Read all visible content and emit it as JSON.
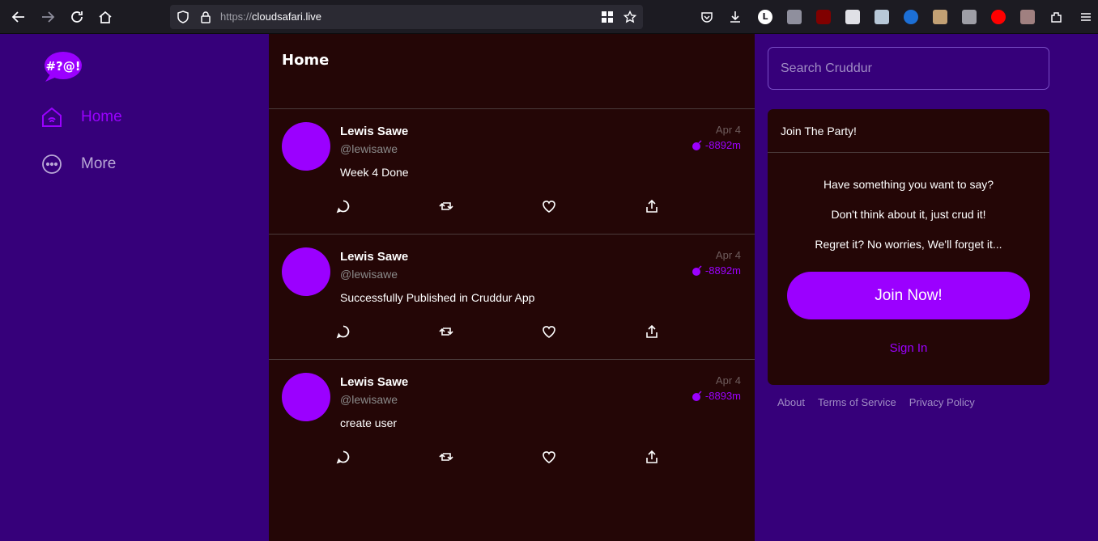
{
  "browser": {
    "url_scheme": "https://",
    "url_host": "cloudsafari.live",
    "icons": [
      "back-icon",
      "forward-icon",
      "reload-icon",
      "home-icon",
      "shield-icon",
      "lock-icon",
      "grid-icon",
      "star-icon",
      "pocket-icon",
      "download-icon",
      "extensions-icon",
      "menu-icon"
    ]
  },
  "app": {
    "logo_text": "#?@!",
    "nav": [
      {
        "label": "Home",
        "icon": "home-icon",
        "active": true
      },
      {
        "label": "More",
        "icon": "more-icon",
        "active": false
      }
    ]
  },
  "feed": {
    "title": "Home",
    "posts": [
      {
        "name": "Lewis Sawe",
        "handle": "@lewisawe",
        "text": "Week 4 Done",
        "date": "Apr 4",
        "expiry": "-8892m"
      },
      {
        "name": "Lewis Sawe",
        "handle": "@lewisawe",
        "text": "Successfully Published in Cruddur App",
        "date": "Apr 4",
        "expiry": "-8892m"
      },
      {
        "name": "Lewis Sawe",
        "handle": "@lewisawe",
        "text": "create user",
        "date": "Apr 4",
        "expiry": "-8893m"
      }
    ]
  },
  "right": {
    "search_placeholder": "Search Cruddur",
    "party_title": "Join The Party!",
    "party_lines": [
      "Have something you want to say?",
      "Don't think about it, just crud it!",
      "Regret it? No worries, We'll forget it..."
    ],
    "join_label": "Join Now!",
    "signin_label": "Sign In",
    "footer": [
      "About",
      "Terms of Service",
      "Privacy Policy"
    ]
  },
  "colors": {
    "accent": "#9b00ff",
    "background": "#36007a",
    "panel": "#240606"
  }
}
